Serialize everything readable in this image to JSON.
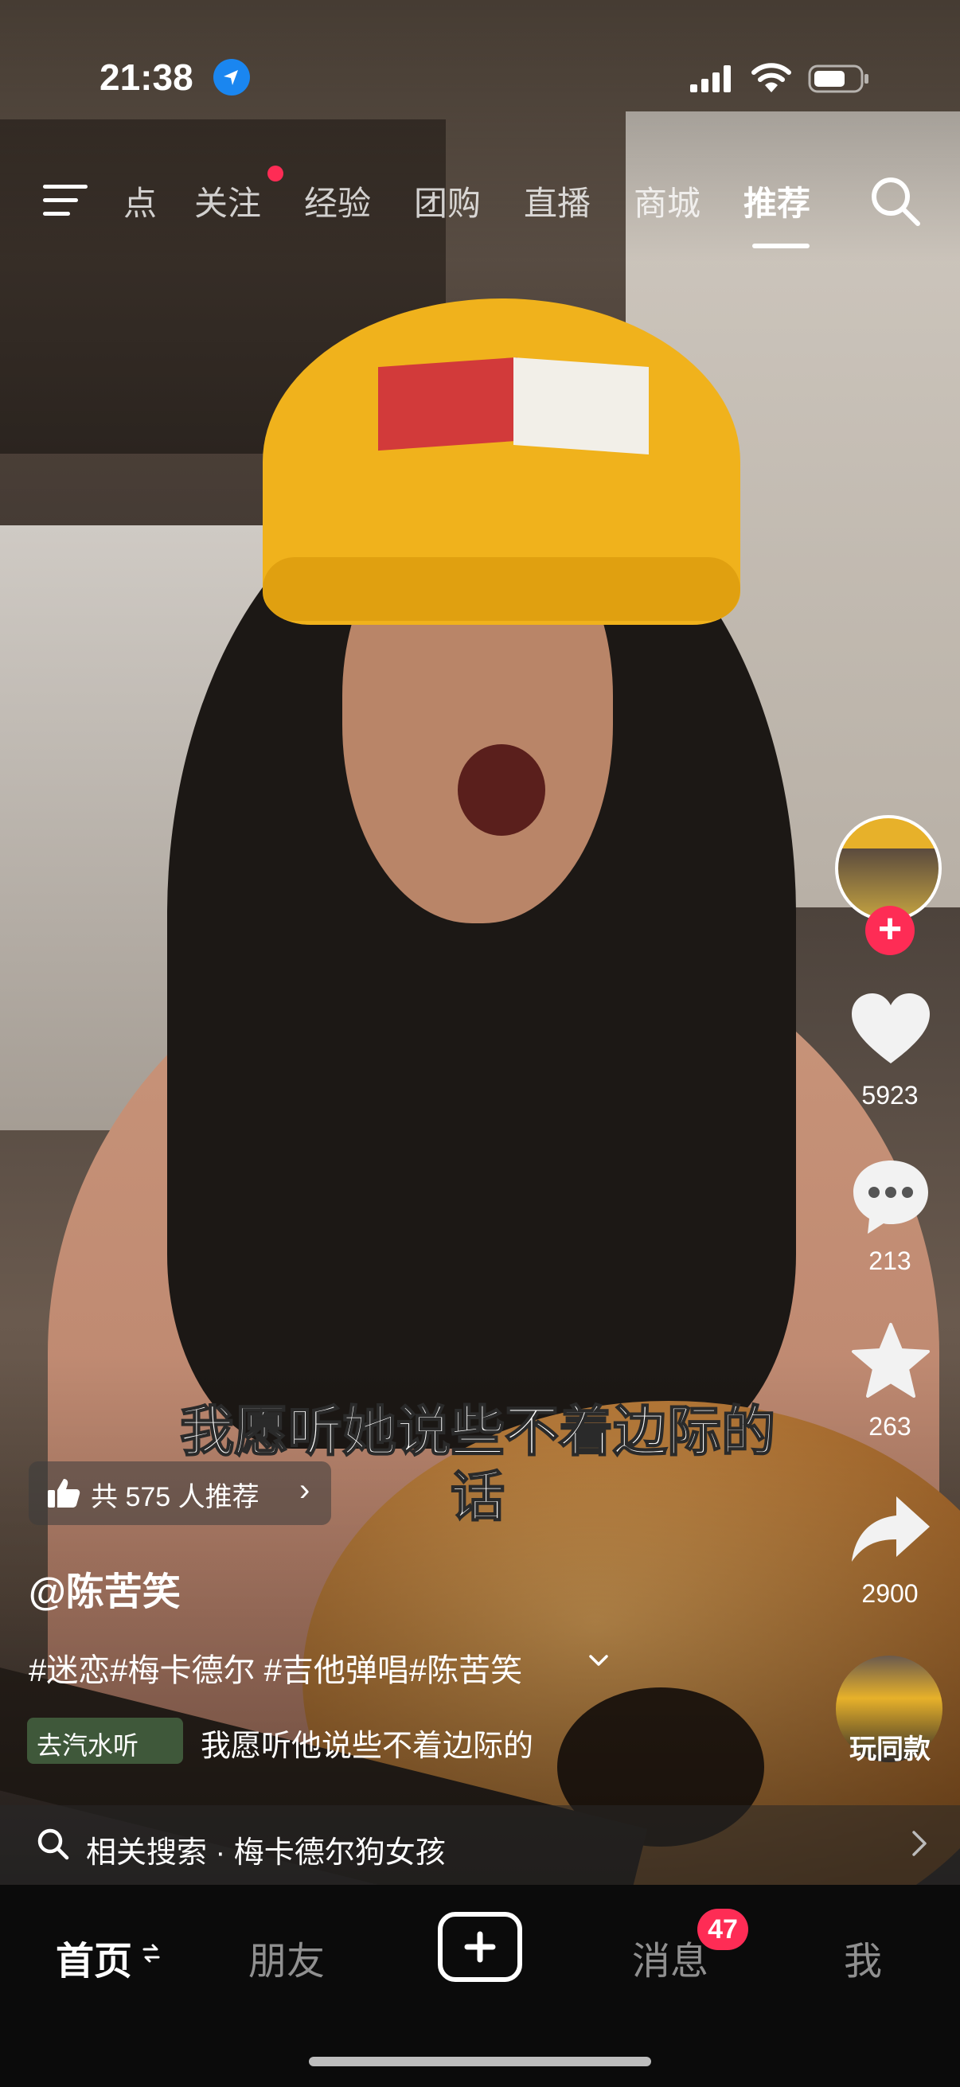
{
  "status_bar": {
    "time": "21:38"
  },
  "top_nav": {
    "tabs": [
      "点",
      "关注",
      "经验",
      "团购",
      "直播",
      "商城",
      "推荐"
    ],
    "active_tab": "推荐"
  },
  "video": {
    "subtitle_line1": "我愿听她说些不着边际的",
    "subtitle_line2": "话"
  },
  "right_rail": {
    "likes": "5923",
    "comments": "213",
    "favorites": "263",
    "shares": "2900",
    "same_style_label": "玩同款"
  },
  "recommend_pill": {
    "text": "共 575 人推荐"
  },
  "post": {
    "author": "@陈苦笑",
    "hashtags": "#迷恋#梅卡德尔 #吉他弹唱#陈苦笑",
    "music_tag": "去汽水听",
    "music_title": "我愿听他说些不着边际的"
  },
  "related_search": {
    "text": "相关搜索 · 梅卡德尔狗女孩"
  },
  "tab_bar": {
    "home": "首页",
    "friends": "朋友",
    "messages": "消息",
    "messages_badge": "47",
    "me": "我"
  },
  "colors": {
    "accent": "#fe2c55",
    "location_blue": "#1a86f0"
  }
}
